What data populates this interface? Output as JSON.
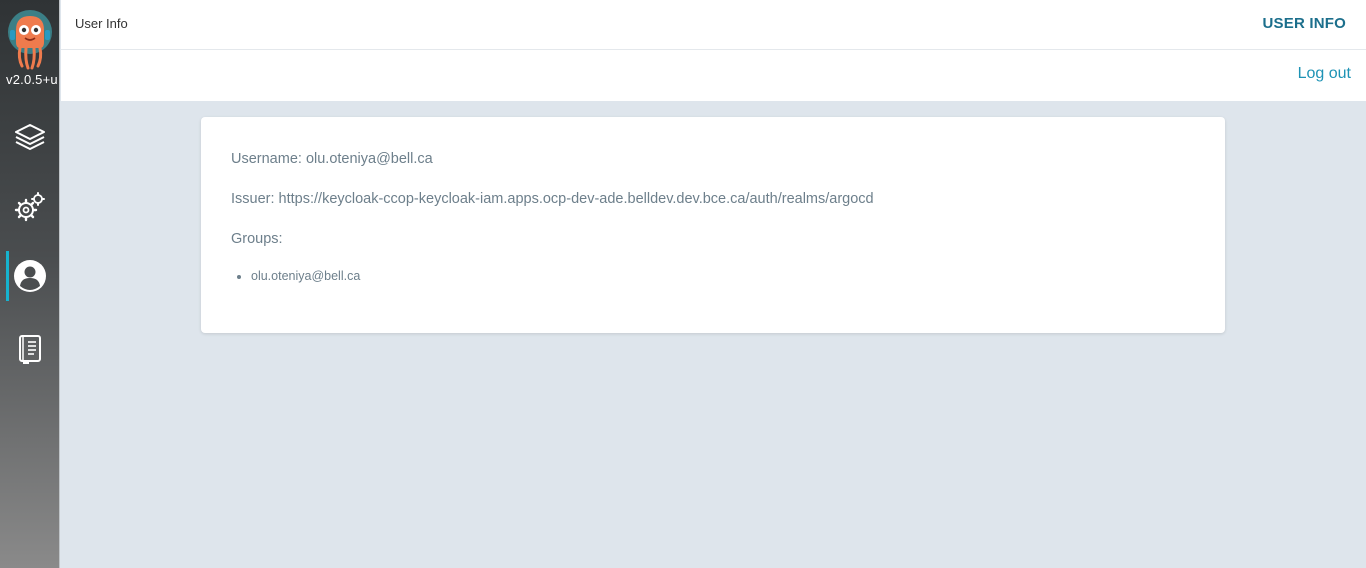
{
  "app": {
    "version": "v2.0.5+u",
    "accent_color": "#16b3cf"
  },
  "sidebar": {
    "items": [
      {
        "name": "applications",
        "icon": "layers-icon",
        "active": false
      },
      {
        "name": "settings",
        "icon": "gears-icon",
        "active": false
      },
      {
        "name": "user-info",
        "icon": "user-circle-icon",
        "active": true
      },
      {
        "name": "docs",
        "icon": "book-icon",
        "active": false
      }
    ]
  },
  "header": {
    "title": "User Info",
    "right_link": "USER INFO"
  },
  "toolbar": {
    "logout_label": "Log out"
  },
  "user": {
    "username_line": "Username: olu.oteniya@bell.ca",
    "issuer_line": "Issuer: https://keycloak-ccop-keycloak-iam.apps.ocp-dev-ade.belldev.dev.bce.ca/auth/realms/argocd",
    "groups_label": "Groups:",
    "groups": [
      "olu.oteniya@bell.ca"
    ]
  }
}
